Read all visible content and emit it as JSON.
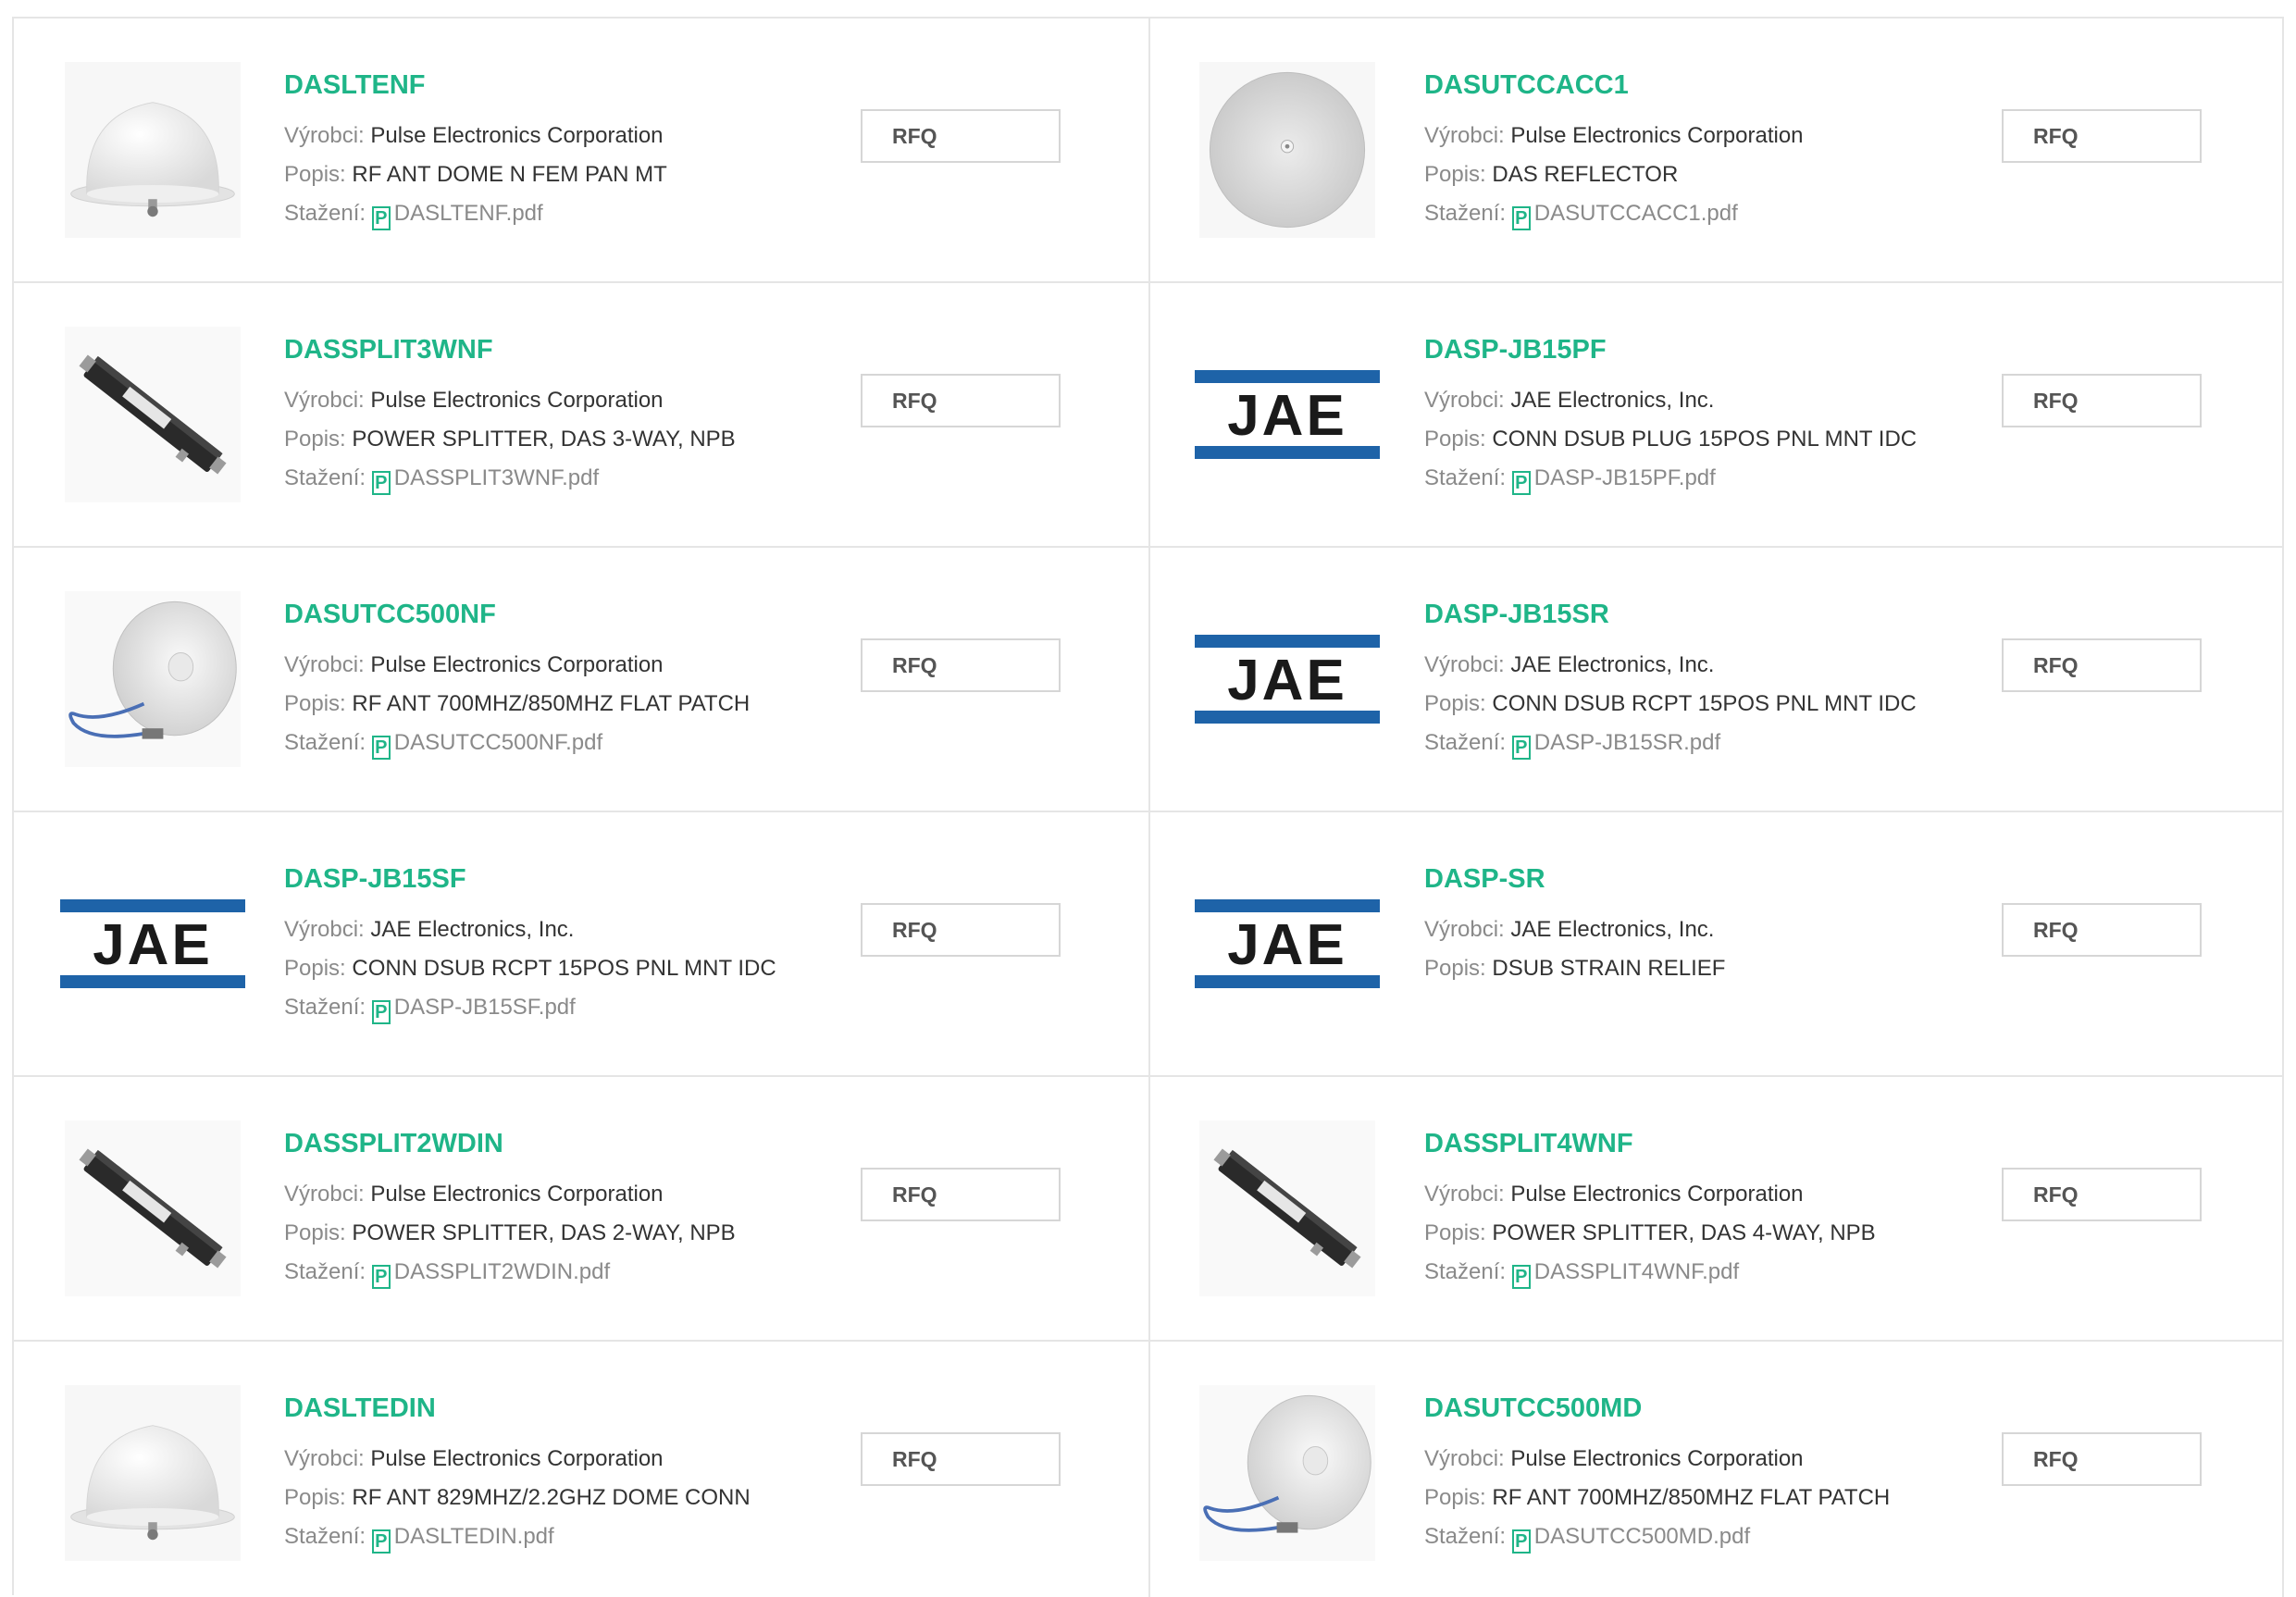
{
  "labels": {
    "manufacturer": "Výrobci: ",
    "description": "Popis: ",
    "download": "Stažení: ",
    "rfq": "RFQ",
    "pdf_icon_glyph": "P"
  },
  "colors": {
    "product_name": "#1fb588",
    "label": "#8a8a8a",
    "jae_blue": "#1e63a8"
  },
  "products": [
    {
      "name": "DASLTENF",
      "manufacturer": "Pulse Electronics Corporation",
      "description": "RF ANT DOME N FEM PAN MT",
      "file": "DASLTENF.pdf",
      "image": "dome-antenna"
    },
    {
      "name": "DASUTCCACC1",
      "manufacturer": "Pulse Electronics Corporation",
      "description": "DAS REFLECTOR",
      "file": "DASUTCCACC1.pdf",
      "image": "reflector-disc"
    },
    {
      "name": "DASSPLIT3WNF",
      "manufacturer": "Pulse Electronics Corporation",
      "description": "POWER SPLITTER, DAS 3-WAY, NPB",
      "file": "DASSPLIT3WNF.pdf",
      "image": "power-splitter"
    },
    {
      "name": "DASP-JB15PF",
      "manufacturer": "JAE Electronics, Inc.",
      "description": "CONN DSUB PLUG 15POS PNL MNT IDC",
      "file": "DASP-JB15PF.pdf",
      "image": "jae-logo"
    },
    {
      "name": "DASUTCC500NF",
      "manufacturer": "Pulse Electronics Corporation",
      "description": "RF ANT 700MHZ/850MHZ FLAT PATCH",
      "file": "DASUTCC500NF.pdf",
      "image": "patch-antenna"
    },
    {
      "name": "DASP-JB15SR",
      "manufacturer": "JAE Electronics, Inc.",
      "description": "CONN DSUB RCPT 15POS PNL MNT IDC",
      "file": "DASP-JB15SR.pdf",
      "image": "jae-logo"
    },
    {
      "name": "DASP-JB15SF",
      "manufacturer": "JAE Electronics, Inc.",
      "description": "CONN DSUB RCPT 15POS PNL MNT IDC",
      "file": "DASP-JB15SF.pdf",
      "image": "jae-logo"
    },
    {
      "name": "DASP-SR",
      "manufacturer": "JAE Electronics, Inc.",
      "description": "DSUB STRAIN RELIEF",
      "file": null,
      "image": "jae-logo"
    },
    {
      "name": "DASSPLIT2WDIN",
      "manufacturer": "Pulse Electronics Corporation",
      "description": "POWER SPLITTER, DAS 2-WAY, NPB",
      "file": "DASSPLIT2WDIN.pdf",
      "image": "power-splitter"
    },
    {
      "name": "DASSPLIT4WNF",
      "manufacturer": "Pulse Electronics Corporation",
      "description": "POWER SPLITTER, DAS 4-WAY, NPB",
      "file": "DASSPLIT4WNF.pdf",
      "image": "power-splitter"
    },
    {
      "name": "DASLTEDIN",
      "manufacturer": "Pulse Electronics Corporation",
      "description": "RF ANT 829MHZ/2.2GHZ DOME CONN",
      "file": "DASLTEDIN.pdf",
      "image": "dome-antenna"
    },
    {
      "name": "DASUTCC500MD",
      "manufacturer": "Pulse Electronics Corporation",
      "description": "RF ANT 700MHZ/850MHZ FLAT PATCH",
      "file": "DASUTCC500MD.pdf",
      "image": "patch-antenna"
    }
  ]
}
